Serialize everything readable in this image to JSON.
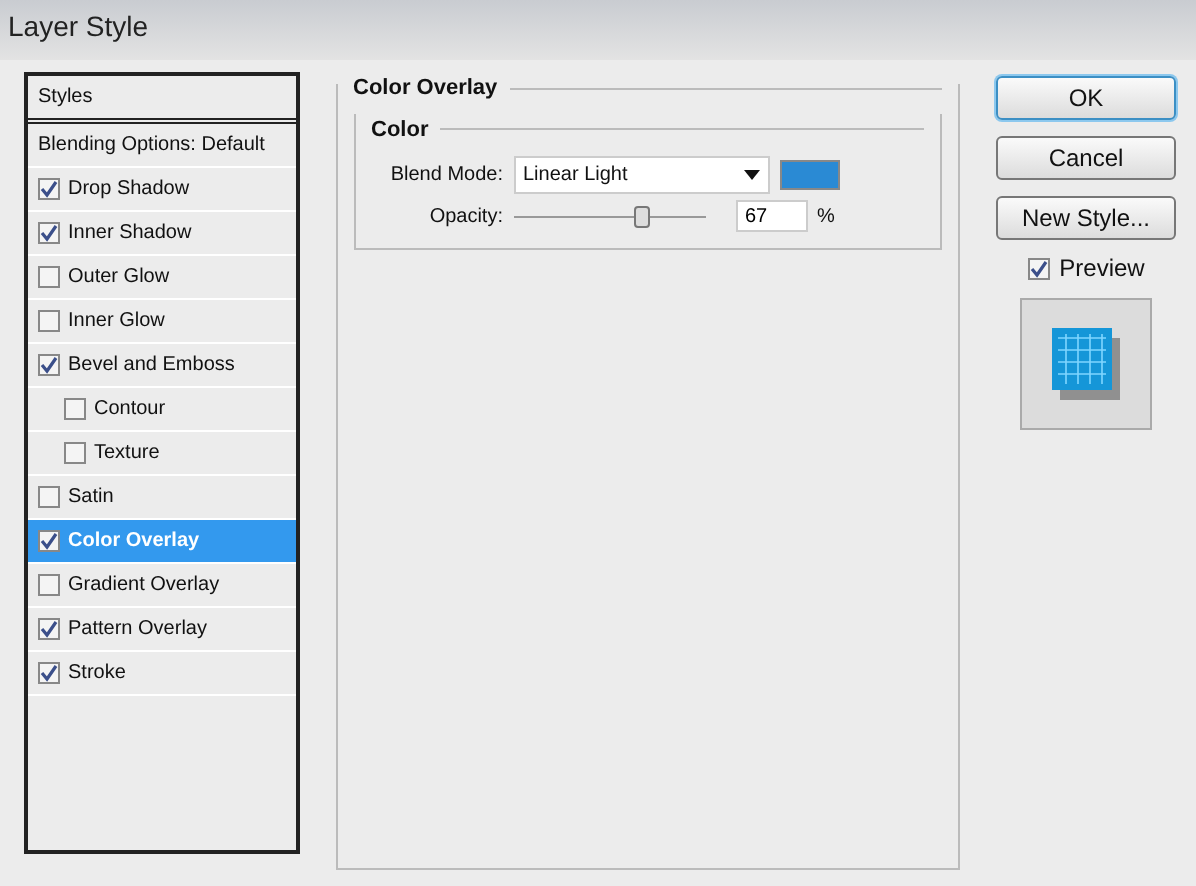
{
  "window": {
    "title": "Layer Style"
  },
  "sidebar": {
    "header": "Styles",
    "blending_options": {
      "label": "Blending Options: Default",
      "selected": false
    },
    "items": [
      {
        "label": "Drop Shadow",
        "checked": true,
        "selected": false
      },
      {
        "label": "Inner Shadow",
        "checked": true,
        "selected": false
      },
      {
        "label": "Outer Glow",
        "checked": false,
        "selected": false
      },
      {
        "label": "Inner Glow",
        "checked": false,
        "selected": false
      },
      {
        "label": "Bevel and Emboss",
        "checked": true,
        "selected": false,
        "children": [
          {
            "label": "Contour",
            "checked": false,
            "selected": false
          },
          {
            "label": "Texture",
            "checked": false,
            "selected": false
          }
        ]
      },
      {
        "label": "Satin",
        "checked": false,
        "selected": false
      },
      {
        "label": "Color Overlay",
        "checked": true,
        "selected": true
      },
      {
        "label": "Gradient Overlay",
        "checked": false,
        "selected": false
      },
      {
        "label": "Pattern Overlay",
        "checked": true,
        "selected": false
      },
      {
        "label": "Stroke",
        "checked": true,
        "selected": false
      }
    ]
  },
  "panel": {
    "title": "Color Overlay",
    "group_title": "Color",
    "blend_mode": {
      "label": "Blend Mode:",
      "value": "Linear Light",
      "color": "#2a8ad4"
    },
    "opacity": {
      "label": "Opacity:",
      "level": 0.67,
      "value": "67",
      "unit": "%"
    }
  },
  "buttons": [
    "OK",
    "Cancel",
    "New Style..."
  ],
  "preview": {
    "label": "Preview",
    "checked": true
  }
}
